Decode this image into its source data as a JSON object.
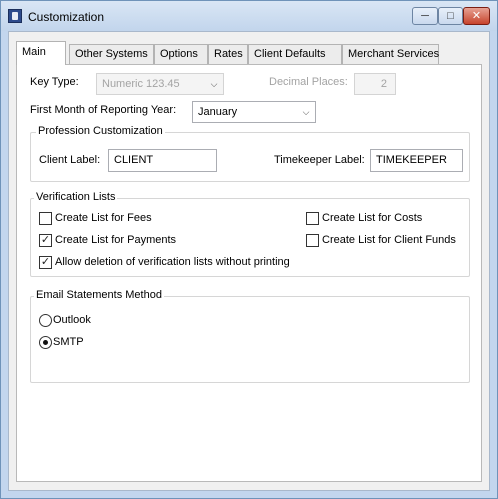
{
  "window": {
    "title": "Customization",
    "minimize": "─",
    "maximize": "□",
    "close": "✕"
  },
  "tabs": [
    "Main",
    "Other Systems",
    "Options",
    "Rates",
    "Client Defaults",
    "Merchant Services"
  ],
  "key_type": {
    "label": "Key Type:",
    "value": "Numeric   123.45",
    "arrow": "⌵"
  },
  "decimal_places": {
    "label": "Decimal Places:",
    "value": "2"
  },
  "first_month": {
    "label": "First Month of Reporting Year:",
    "value": "January",
    "arrow": "⌵"
  },
  "profession": {
    "legend": "Profession Customization",
    "client_label": "Client Label:",
    "client_value": "CLIENT",
    "timekeeper_label": "Timekeeper Label:",
    "timekeeper_value": "TIMEKEEPER"
  },
  "verification": {
    "legend": "Verification Lists",
    "fees": {
      "label": "Create List for Fees",
      "checked": false
    },
    "costs": {
      "label": "Create List for Costs",
      "checked": false
    },
    "payments": {
      "label": "Create List for Payments",
      "checked": true
    },
    "client_funds": {
      "label": "Create List for Client Funds",
      "checked": false
    },
    "allow_deletion": {
      "label": "Allow deletion of verification lists without printing",
      "checked": true
    },
    "check_mark": "✓"
  },
  "email": {
    "legend": "Email Statements Method",
    "outlook": {
      "label": "Outlook",
      "selected": false
    },
    "smtp": {
      "label": "SMTP",
      "selected": true
    }
  }
}
